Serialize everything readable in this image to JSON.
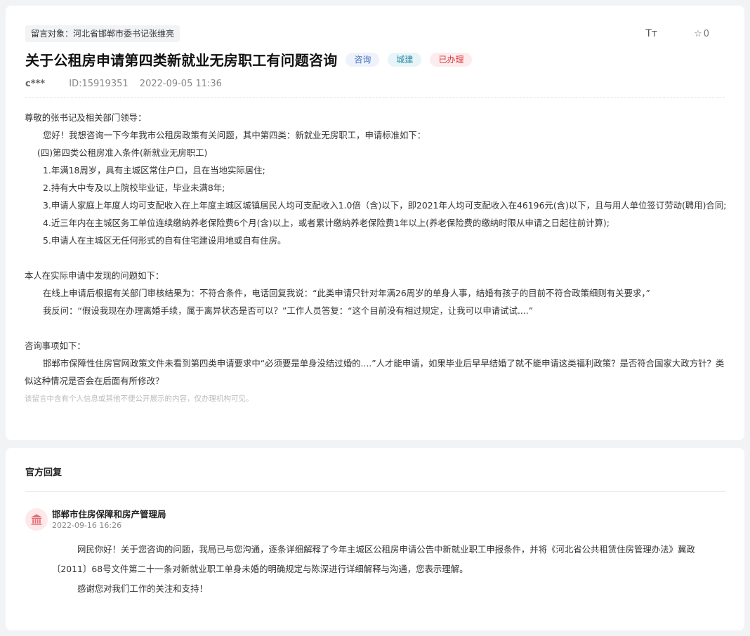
{
  "message": {
    "target_label": "留言对象：河北省邯郸市委书记张维亮",
    "font_tool_label": "Tт",
    "favorite_count": "0",
    "title": "关于公租房申请第四类新就业无房职工有问题咨询",
    "tags": [
      "咨询",
      "城建",
      "已办理"
    ],
    "author": "c***",
    "id_text": "ID:15919351",
    "date": "2022-09-05 11:36",
    "paragraphs": [
      "尊敬的张书记及相关部门领导：",
      "您好！我想咨询一下今年我市公租房政策有关问题，其中第四类：新就业无房职工，申请标准如下：",
      "(四)第四类公租房准入条件(新就业无房职工)",
      "1.年满18周岁，具有主城区常住户口，且在当地实际居住;",
      "2.持有大中专及以上院校毕业证，毕业未满8年;",
      "3.申请人家庭上年度人均可支配收入在上年度主城区城镇居民人均可支配收入1.0倍（含)以下，即2021年人均可支配收入在46196元(含)以下，且与用人单位签订劳动(聘用)合同;",
      "4.近三年内在主城区务工单位连续缴纳养老保险费6个月(含)以上，或者累计缴纳养老保险费1年以上(养老保险费的缴纳时限从申请之日起往前计算);",
      "5.申请人在主城区无任何形式的自有住宅建设用地或自有住房。",
      "本人在实际申请中发现的问题如下：",
      "在线上申请后根据有关部门审核结果为：不符合条件，电话回复我说：“此类申请只针对年满26周岁的单身人事，结婚有孩子的目前不符合政策细则有关要求，”",
      "我反问：“假设我现在办理离婚手续，属于离异状态是否可以？”工作人员答复：“这个目前没有相过规定，让我可以申请试试....”",
      "咨询事项如下：",
      "邯郸市保障性住房官网政策文件未看到第四类申请要求中“必须要是单身没结过婚的....”人才能申请，如果毕业后早早结婚了就不能申请这类福利政策？是否符合国家大政方针？类似这种情况是否会在后面有所修改？"
    ],
    "notice": "该留言中含有个人信息或其他不便公开展示的内容，仅办理机构可见。"
  },
  "reply": {
    "section_title": "官方回复",
    "department": "邯郸市住房保障和房产管理局",
    "time": "2022-09-16 16:26",
    "paragraphs": [
      "网民你好！关于您咨询的问题，我局已与您沟通，逐条详细解释了今年主城区公租房申请公告中新就业职工申报条件，并将《河北省公共租赁住房管理办法》冀政〔2011〕68号文件第二十一条对新就业职工单身未婚的明确规定与陈深进行详细解释与沟通，您表示理解。",
      "感谢您对我们工作的关注和支持！"
    ]
  },
  "colors": {
    "tag_consult": "#4a70c2",
    "tag_city": "#2b8aa7",
    "tag_done": "#d9363e",
    "dept_icon": "#e56e76"
  },
  "icons": {
    "font_size": "font-size-icon",
    "favorite": "star-icon",
    "department": "government-building-icon"
  }
}
